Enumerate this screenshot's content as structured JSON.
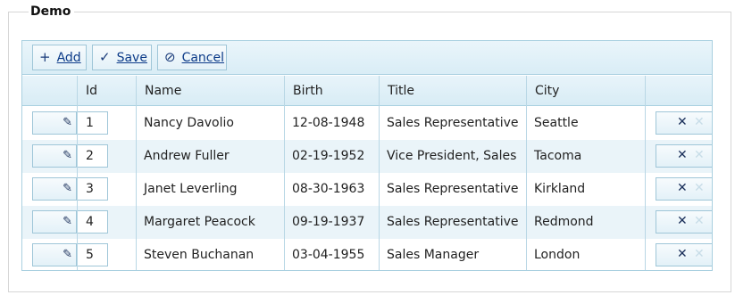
{
  "legend": "Demo",
  "toolbar": {
    "add_label": "Add",
    "save_label": "Save",
    "cancel_label": "Cancel",
    "add_icon": "+",
    "save_icon": "✓",
    "cancel_icon": "⊘"
  },
  "columns": [
    "Id",
    "Name",
    "Birth",
    "Title",
    "City"
  ],
  "rows": [
    {
      "id": "1",
      "name": "Nancy Davolio",
      "birth": "12-08-1948",
      "title": "Sales Representative",
      "city": "Seattle"
    },
    {
      "id": "2",
      "name": "Andrew Fuller",
      "birth": "02-19-1952",
      "title": "Vice President, Sales",
      "city": "Tacoma"
    },
    {
      "id": "3",
      "name": "Janet Leverling",
      "birth": "08-30-1963",
      "title": "Sales Representative",
      "city": "Kirkland"
    },
    {
      "id": "4",
      "name": "Margaret Peacock",
      "birth": "09-19-1937",
      "title": "Sales Representative",
      "city": "Redmond"
    },
    {
      "id": "5",
      "name": "Steven Buchanan",
      "birth": "03-04-1955",
      "title": "Sales Manager",
      "city": "London"
    }
  ],
  "icons": {
    "edit": "pencil-icon",
    "delete": "close-icon"
  },
  "colors": {
    "border": "#a9d0e0",
    "alt_row": "#eaf4f9",
    "link": "#0b3a88"
  }
}
